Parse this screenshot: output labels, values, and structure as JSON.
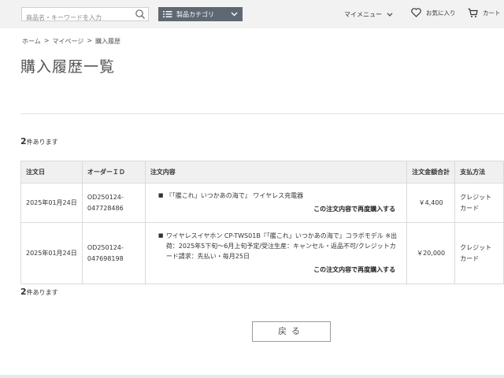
{
  "header": {
    "search_placeholder": "商品名・キーワードを入力",
    "category_label": "製品カテゴリ",
    "mymenu_label": "マイメニュー",
    "favorites_label": "お気に入り",
    "cart_label": "カート"
  },
  "breadcrumb": [
    "ホーム",
    ">",
    "マイページ",
    ">",
    "購入履歴"
  ],
  "page_title": "購入履歴一覧",
  "count": {
    "number": "2",
    "suffix": "件あります"
  },
  "table": {
    "headers": [
      "注文日",
      "オーダーＩＤ",
      "注文内容",
      "注文金額合計",
      "支払方法"
    ],
    "rows": [
      {
        "date": "2025年01月24日",
        "order_id_line1": "OD250124-",
        "order_id_line2": "047728486",
        "item": "『「艦これ」いつかあの海で』 ワイヤレス充電器",
        "rebuy": "この注文内容で再度購入する",
        "total": "￥4,400",
        "payment_line1": "クレジット",
        "payment_line2": "カード"
      },
      {
        "date": "2025年01月24日",
        "order_id_line1": "OD250124-",
        "order_id_line2": "047698198",
        "item": "ワイヤレスイヤホン CP-TWS01B『「艦これ」いつかあの海で』コラボモデル ※出荷：2025年5下旬～6月上旬予定/受注生産：キャンセル・返品不可/クレジットカード請求：先払い・毎月25日",
        "rebuy": "この注文内容で再度購入する",
        "total": "￥20,000",
        "payment_line1": "クレジット",
        "payment_line2": "カード"
      }
    ]
  },
  "back_button": "戻る"
}
